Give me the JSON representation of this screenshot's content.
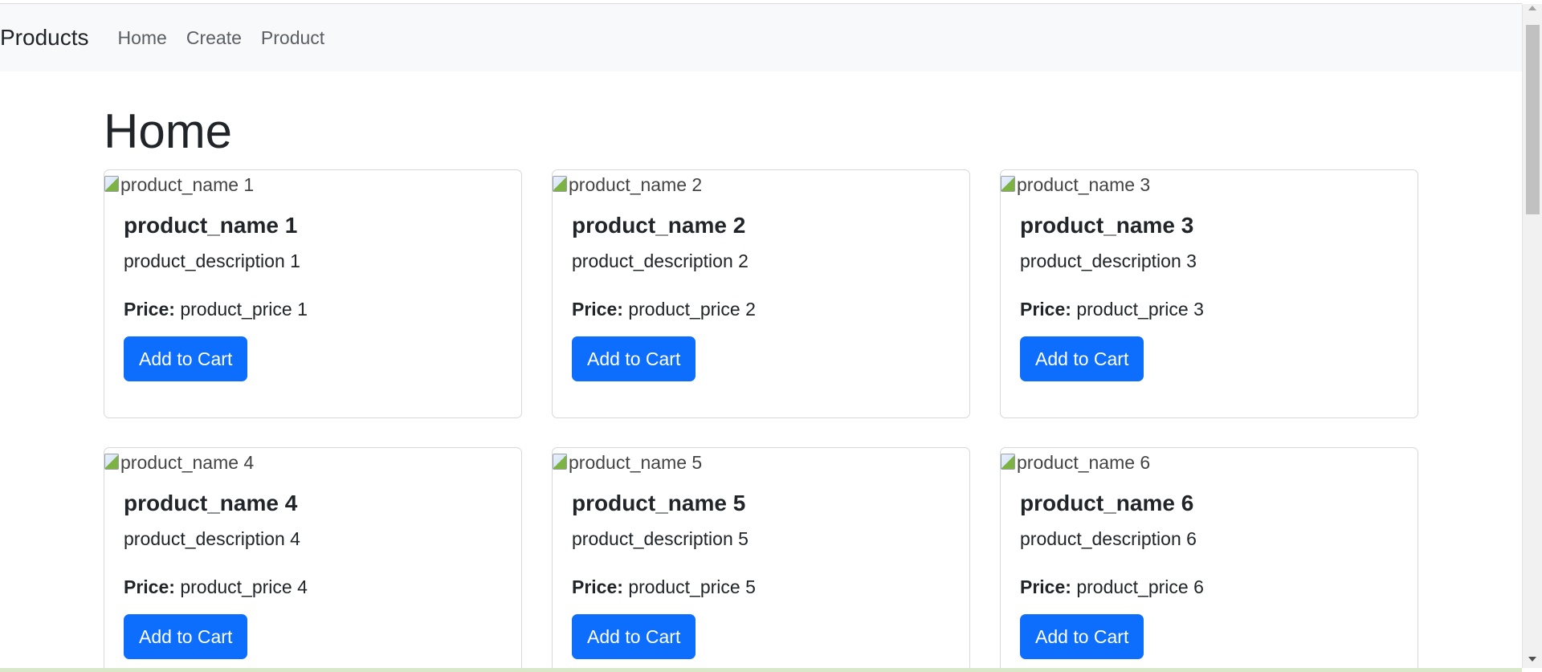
{
  "navbar": {
    "brand": "Products",
    "links": [
      {
        "label": "Home"
      },
      {
        "label": "Create"
      },
      {
        "label": "Product"
      }
    ]
  },
  "main": {
    "title": "Home",
    "price_label": "Price:",
    "add_to_cart_label": "Add to Cart",
    "products": [
      {
        "image_alt": "product_name 1",
        "name": "product_name 1",
        "description": "product_description 1",
        "price": "product_price 1"
      },
      {
        "image_alt": "product_name 2",
        "name": "product_name 2",
        "description": "product_description 2",
        "price": "product_price 2"
      },
      {
        "image_alt": "product_name 3",
        "name": "product_name 3",
        "description": "product_description 3",
        "price": "product_price 3"
      },
      {
        "image_alt": "product_name 4",
        "name": "product_name 4",
        "description": "product_description 4",
        "price": "product_price 4"
      },
      {
        "image_alt": "product_name 5",
        "name": "product_name 5",
        "description": "product_description 5",
        "price": "product_price 5"
      },
      {
        "image_alt": "product_name 6",
        "name": "product_name 6",
        "description": "product_description 6",
        "price": "product_price 6"
      }
    ]
  },
  "colors": {
    "primary": "#0d6efd",
    "navbar_bg": "#f8f9fa",
    "text": "#212529"
  }
}
